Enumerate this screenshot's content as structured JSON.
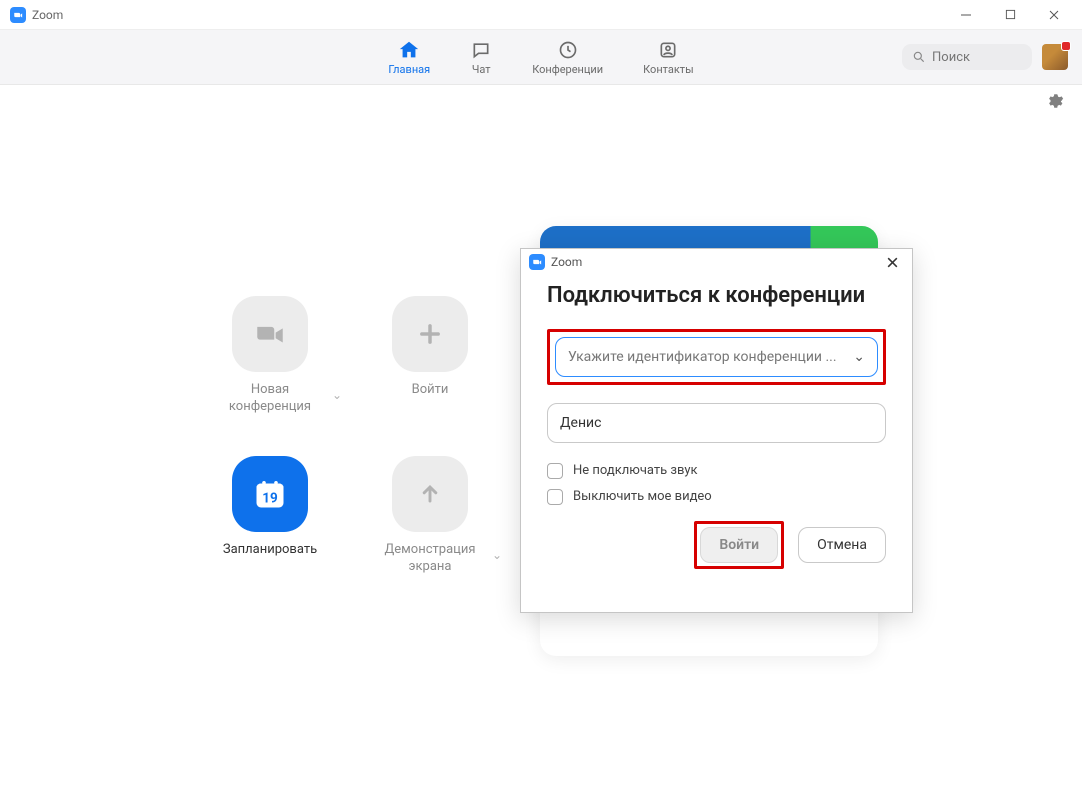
{
  "window": {
    "title": "Zoom"
  },
  "nav": {
    "items": [
      {
        "label": "Главная"
      },
      {
        "label": "Чат"
      },
      {
        "label": "Конференции"
      },
      {
        "label": "Контакты"
      }
    ]
  },
  "search": {
    "placeholder": "Поиск"
  },
  "tiles": {
    "new_meeting": {
      "label": "Новая\nконференция"
    },
    "join": {
      "label": "Войти"
    },
    "schedule": {
      "label": "Запланировать",
      "day": "19"
    },
    "share": {
      "label": "Демонстрация\nэкрана"
    }
  },
  "dialog": {
    "title": "Zoom",
    "heading": "Подключиться к конференции",
    "id_placeholder": "Укажите идентификатор конференции ...",
    "name_value": "Денис",
    "check_no_audio": "Не подключать звук",
    "check_no_video": "Выключить мое видео",
    "join_btn": "Войти",
    "cancel_btn": "Отмена"
  }
}
